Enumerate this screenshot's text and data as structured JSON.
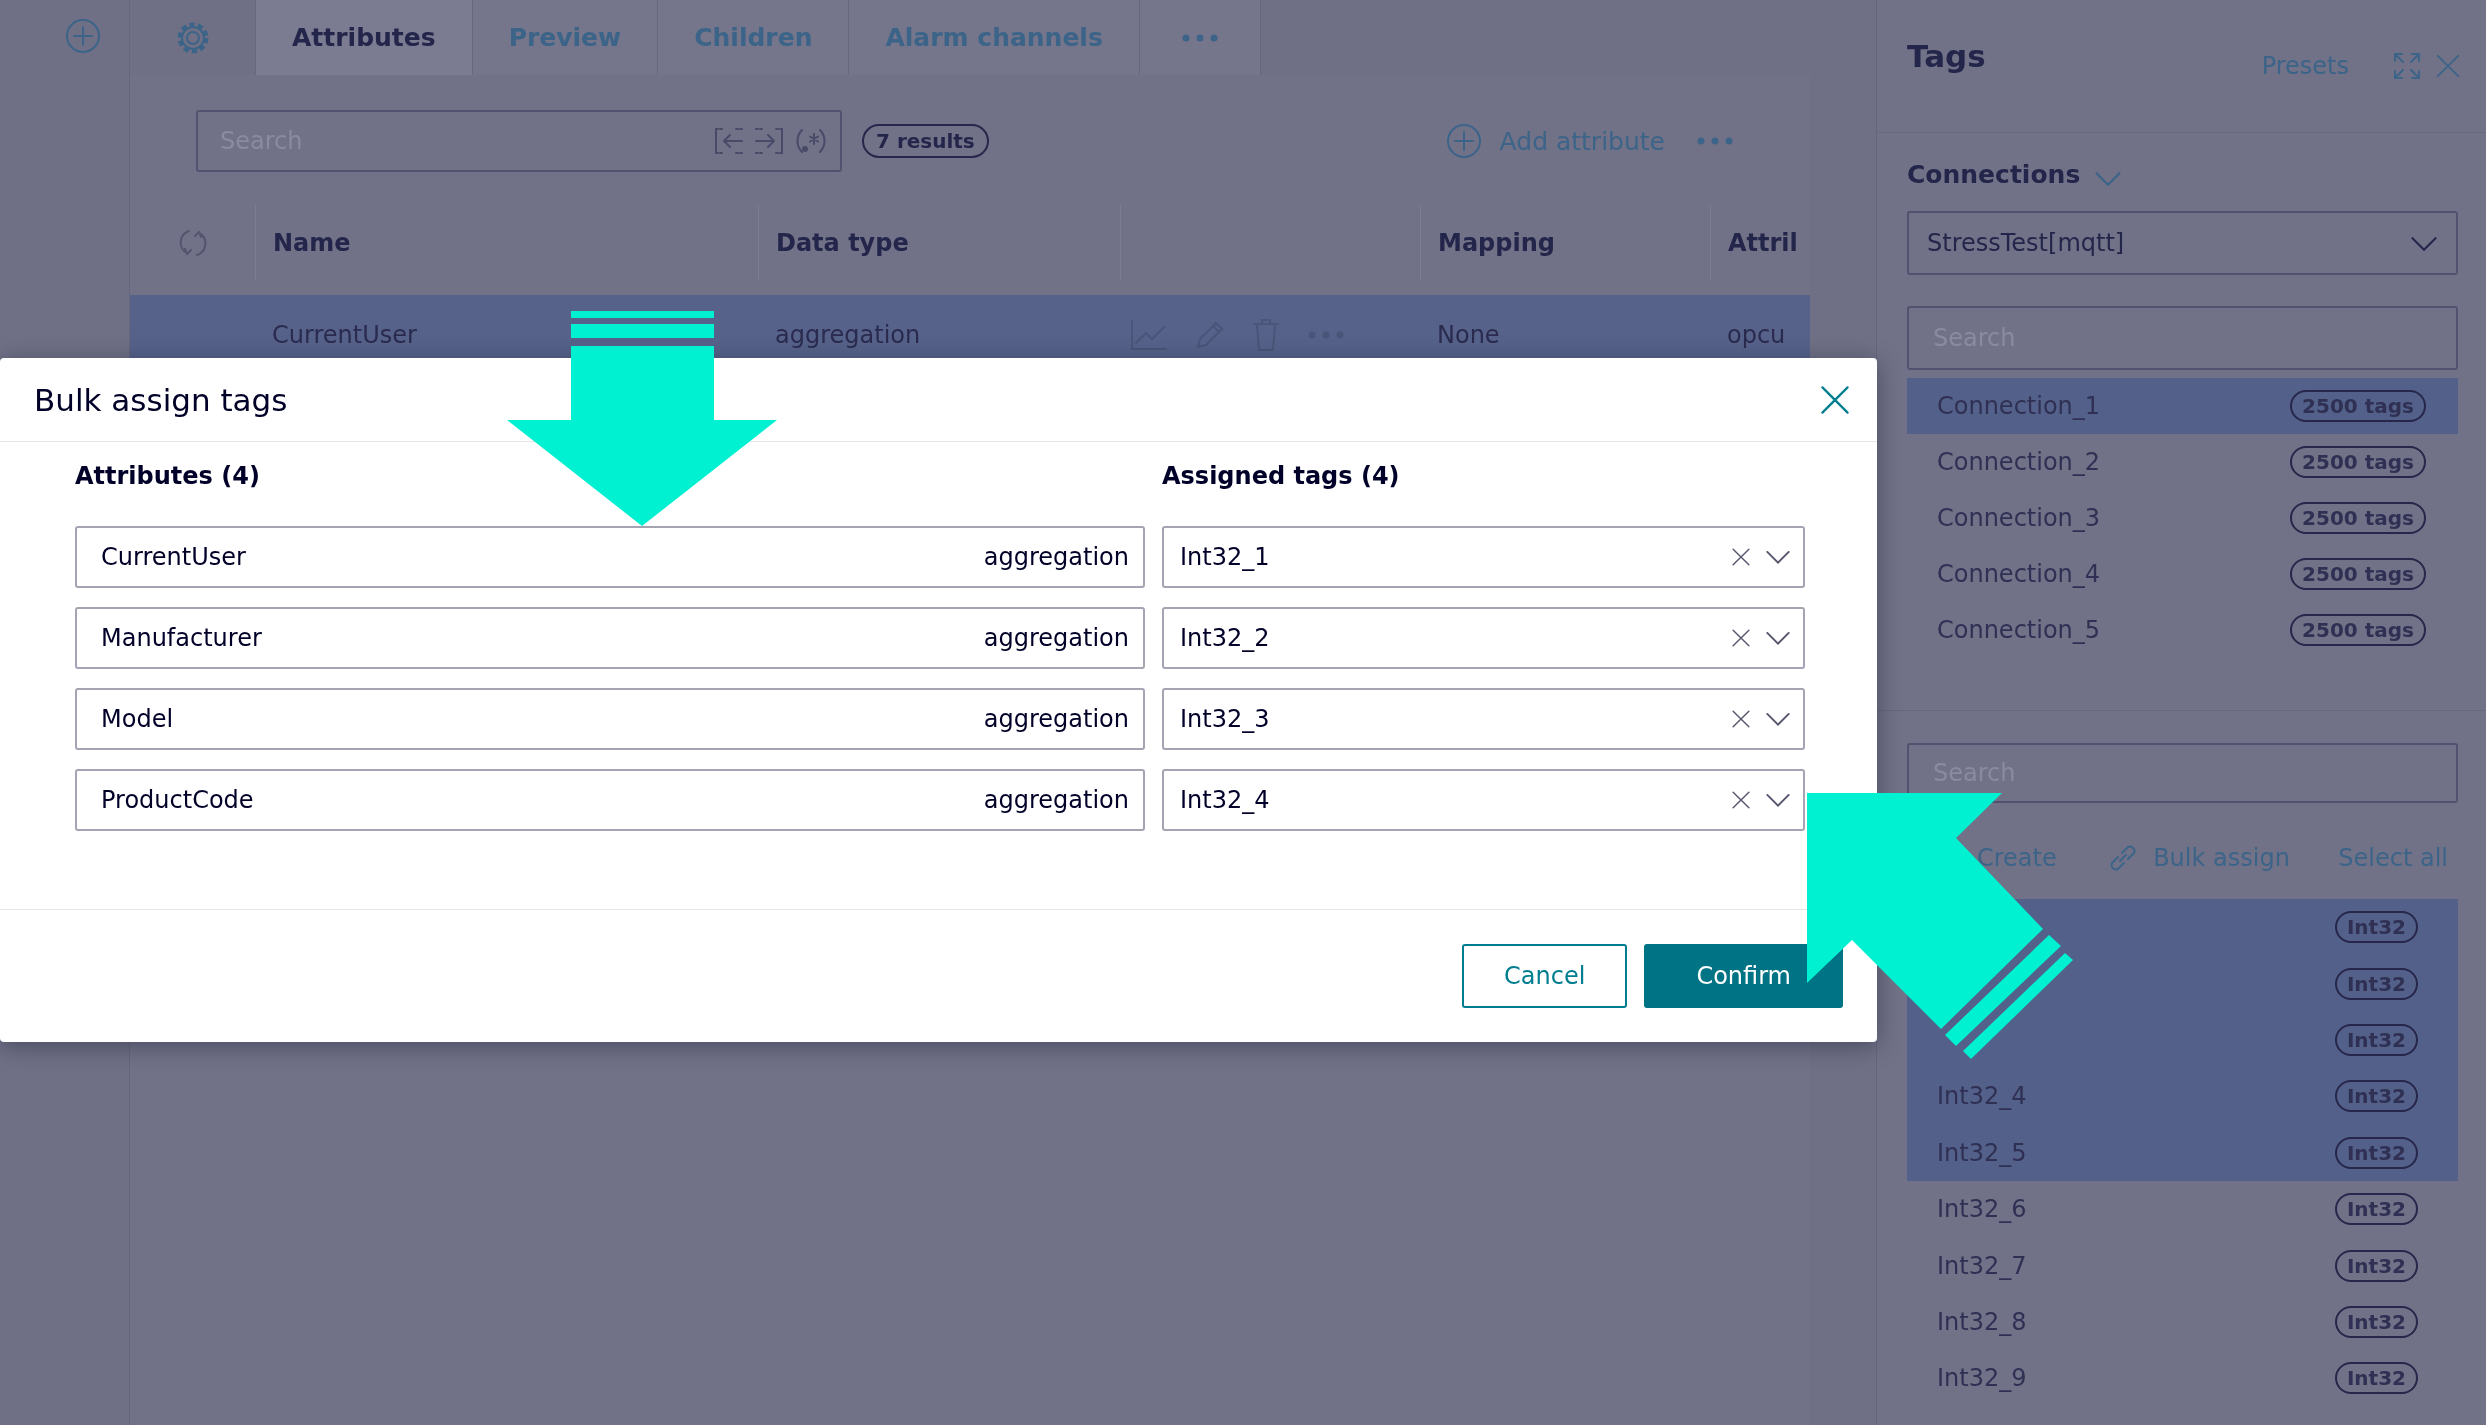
{
  "tabs": [
    {
      "label": "Attributes",
      "selected": true
    },
    {
      "label": "Preview",
      "selected": false
    },
    {
      "label": "Children",
      "selected": false
    },
    {
      "label": "Alarm channels",
      "selected": false
    }
  ],
  "toolbar": {
    "search": {
      "placeholder": "Search"
    },
    "results": "7 results",
    "add_button": "Add attribute"
  },
  "table": {
    "columns": [
      "Name",
      "Data type",
      "Mapping",
      "Attril"
    ],
    "rows": [
      {
        "name": "CurrentUser",
        "data_type": "aggregation",
        "mapping": "None",
        "column_4": "opcu",
        "selected": true
      }
    ]
  },
  "tags_panel": {
    "title": "Tags",
    "presets": "Presets",
    "connections_label": "Connections",
    "connection_select": "StressTest[mqtt]",
    "connection_search": {
      "placeholder": "Search"
    },
    "connections": [
      {
        "name": "Connection_1",
        "count": "2500 tags",
        "selected": true
      },
      {
        "name": "Connection_2",
        "count": "2500 tags",
        "selected": false
      },
      {
        "name": "Connection_3",
        "count": "2500 tags",
        "selected": false
      },
      {
        "name": "Connection_4",
        "count": "2500 tags",
        "selected": false
      },
      {
        "name": "Connection_5",
        "count": "2500 tags",
        "selected": false
      }
    ],
    "tag_search": {
      "placeholder": "Search"
    },
    "actions": [
      {
        "kind": "create",
        "label": "Create"
      },
      {
        "kind": "bulk_assign",
        "label": "Bulk assign"
      },
      {
        "kind": "select_all",
        "label": "Select all"
      }
    ],
    "tags": [
      {
        "type": "Int32",
        "selected": true
      },
      {
        "type": "Int32",
        "selected": true
      },
      {
        "type": "Int32",
        "selected": true
      },
      {
        "name": "Int32_4",
        "type": "Int32",
        "selected": true
      },
      {
        "name": "Int32_5",
        "type": "Int32",
        "selected": true
      },
      {
        "name": "Int32_6",
        "type": "Int32",
        "selected": false
      },
      {
        "name": "Int32_7",
        "type": "Int32",
        "selected": false
      },
      {
        "name": "Int32_8",
        "type": "Int32",
        "selected": false
      },
      {
        "name": "Int32_9",
        "type": "Int32",
        "selected": false
      }
    ]
  },
  "dialog": {
    "title": "Bulk assign tags",
    "attributes_heading": "Attributes (4)",
    "tags_heading": "Assigned tags (4)",
    "rows": [
      {
        "attribute": "CurrentUser",
        "type": "aggregation",
        "tag": "Int32_1"
      },
      {
        "attribute": "Manufacturer",
        "type": "aggregation",
        "tag": "Int32_2"
      },
      {
        "attribute": "Model",
        "type": "aggregation",
        "tag": "Int32_3"
      },
      {
        "attribute": "ProductCode",
        "type": "aggregation",
        "tag": "Int32_4"
      }
    ],
    "buttons": [
      {
        "kind": "secondary",
        "label": "Cancel"
      },
      {
        "kind": "primary",
        "label": "Confirm"
      }
    ]
  }
}
